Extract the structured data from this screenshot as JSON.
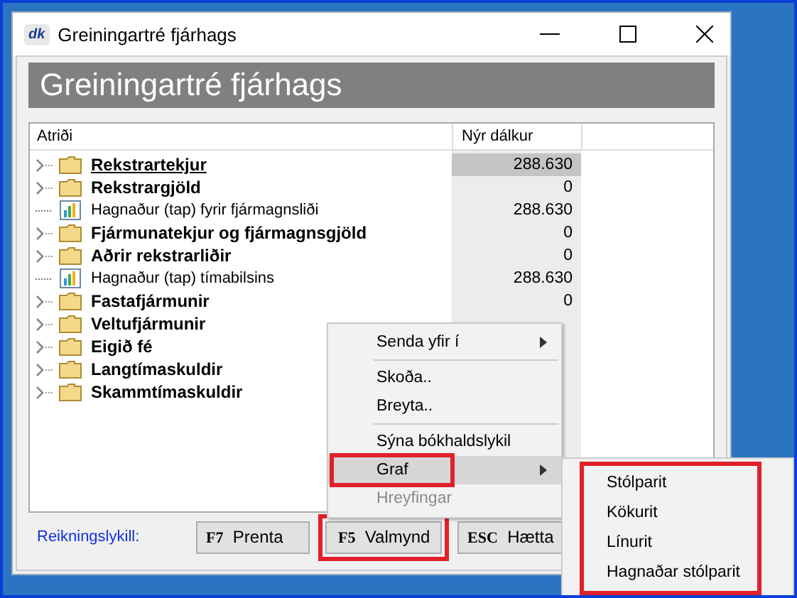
{
  "window": {
    "title": "Greiningartré fjárhags",
    "logo": "dk"
  },
  "header": "Greiningartré fjárhags",
  "columns": [
    "Atriði",
    "Nýr dálkur"
  ],
  "rows": [
    {
      "kind": "folder",
      "label": "Rekstrartekjur",
      "value": "288.630",
      "selected": true
    },
    {
      "kind": "folder",
      "label": "Rekstrargjöld",
      "value": "0",
      "selected": false
    },
    {
      "kind": "chart",
      "label": "Hagnaður (tap) fyrir fjármagnsliði",
      "value": "288.630",
      "selected": false
    },
    {
      "kind": "folder",
      "label": "Fjármunatekjur og fjármagnsgjöld",
      "value": "0",
      "selected": false
    },
    {
      "kind": "folder",
      "label": "Aðrir rekstrarliðir",
      "value": "0",
      "selected": false
    },
    {
      "kind": "chart",
      "label": "Hagnaður (tap) tímabilsins",
      "value": "288.630",
      "selected": false
    },
    {
      "kind": "folder",
      "label": "Fastafjármunir",
      "value": "0",
      "selected": false
    },
    {
      "kind": "folder",
      "label": "Veltufjármunir",
      "selected": false
    },
    {
      "kind": "folder",
      "label": "Eigið fé",
      "selected": false
    },
    {
      "kind": "folder",
      "label": "Langtímaskuldir",
      "selected": false
    },
    {
      "kind": "folder",
      "label": "Skammtímaskuldir",
      "selected": false
    }
  ],
  "footer_link": "Reikningslykill:",
  "buttons": [
    {
      "key": "F7",
      "label": "Prenta",
      "highlighted": false
    },
    {
      "key": "F5",
      "label": "Valmynd",
      "highlighted": true
    },
    {
      "key": "ESC",
      "label": "Hætta",
      "highlighted": false
    }
  ],
  "context_menu": [
    {
      "label": "Senda yfir í",
      "submenu": true,
      "selected": false,
      "disabled": false,
      "highlighted": false,
      "separator_after": true
    },
    {
      "label": "Skoða..",
      "submenu": false,
      "selected": false,
      "disabled": false,
      "highlighted": false,
      "separator_after": false
    },
    {
      "label": "Breyta..",
      "submenu": false,
      "selected": false,
      "disabled": false,
      "highlighted": false,
      "separator_after": true
    },
    {
      "label": "Sýna bókhaldslykil",
      "submenu": false,
      "selected": false,
      "disabled": false,
      "highlighted": false,
      "separator_after": false
    },
    {
      "label": "Graf",
      "submenu": true,
      "selected": true,
      "disabled": false,
      "highlighted": true,
      "separator_after": false
    },
    {
      "label": "Hreyfingar",
      "submenu": false,
      "selected": false,
      "disabled": true,
      "highlighted": false,
      "separator_after": false
    }
  ],
  "submenu": {
    "highlighted": true,
    "items": [
      "Stólparit",
      "Kökurit",
      "Línurit",
      "Hagnaðar stólparit"
    ]
  }
}
